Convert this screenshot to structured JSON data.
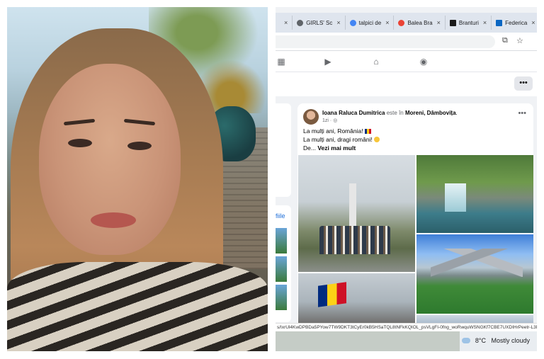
{
  "photo": {
    "alt_subject": "selfie portrait"
  },
  "tabs": [
    {
      "label": "",
      "favicon_color": "#5f6368",
      "close": "×"
    },
    {
      "label": "GIRLS' Sc",
      "favicon_color": "#5f6368",
      "close": "×"
    },
    {
      "label": "talpici de",
      "favicon_color": "#4285f4",
      "close": "×"
    },
    {
      "label": "Balea Bra",
      "favicon_color": "#ea4335",
      "close": "×"
    },
    {
      "label": "Branturi",
      "favicon_color": "#1a1a1a",
      "close": "×"
    },
    {
      "label": "Federica",
      "favicon_color": "#0a66c2",
      "close": "×"
    }
  ],
  "toolbar": {
    "icons": [
      "install-icon",
      "bookmark-star-icon"
    ]
  },
  "fb_nav": {
    "icons": [
      "news-feed-icon",
      "video-icon",
      "marketplace-icon",
      "groups-icon"
    ]
  },
  "subbar": {
    "more_label": "•••"
  },
  "sidebar": {
    "link_label": "fiile"
  },
  "post": {
    "author": "Ioana Raluca Dumitrica",
    "connector": "este în",
    "location": "Moreni, Dâmbovița",
    "time": "1zi",
    "menu_label": "•••",
    "line1": "La mulți ani, România!",
    "line2": "La mulți ani, dragi români!",
    "line3_prefix": "De...",
    "see_more": "Vezi mai mult"
  },
  "status_url": "s/IxrUl4KwDPBDa5PYow7TW9DKT3tCyEr0kB5HSaTQL8tNFkKQIOL_psVLgFI-0fng_woRwquWSNGKf7CBE7UXDIHrPeetr-L3N3r",
  "weather": {
    "temp": "8°C",
    "condition": "Mostly cloudy",
    "icon": "cloud-icon"
  },
  "colors": {
    "fb_blue": "#1d6ed8",
    "text_primary": "#050505",
    "text_muted": "#65676b"
  }
}
